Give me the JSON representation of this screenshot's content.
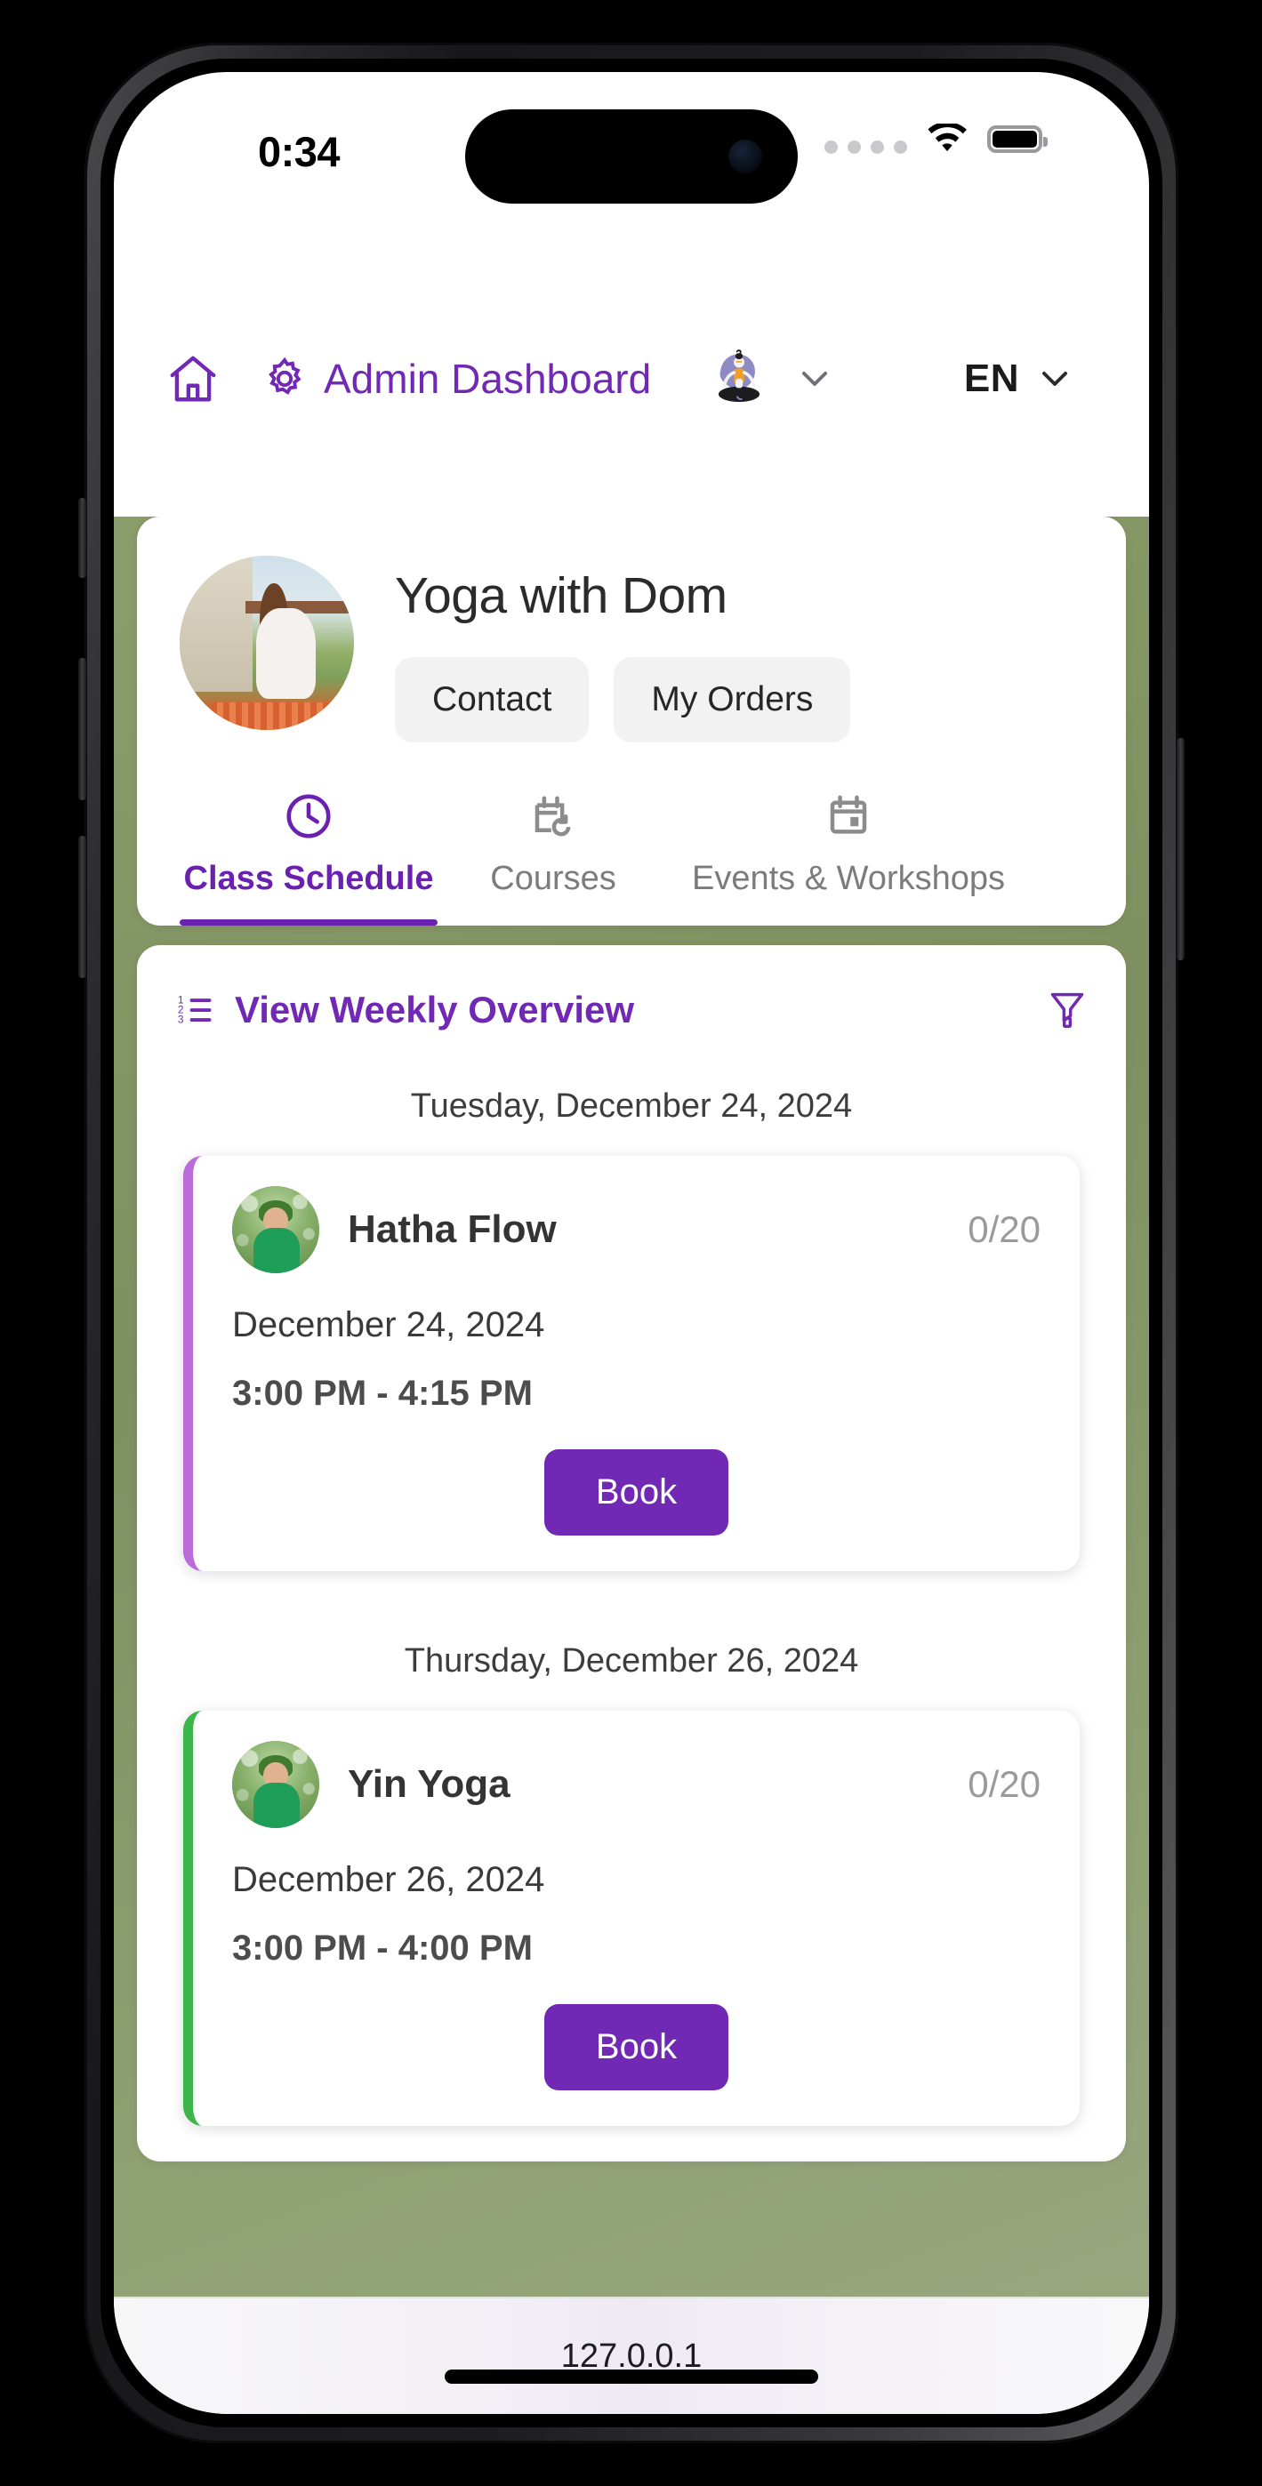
{
  "status_bar": {
    "time": "0:34",
    "signal_icon": "signal-dots-icon",
    "wifi_icon": "wifi-icon",
    "battery_icon": "battery-full-icon"
  },
  "header": {
    "home_icon": "home-icon",
    "gear_icon": "gear-icon",
    "title": "Admin Dashboard",
    "user_avatar_icon": "yoga-meditation-avatar-icon",
    "user_chevron_icon": "chevron-down-icon",
    "language": "EN",
    "language_chevron_icon": "chevron-down-icon",
    "accent_color": "#7028b5"
  },
  "profile": {
    "studio_name": "Yoga with Dom",
    "photo_alt": "yoga-instructor-photo",
    "actions": [
      {
        "label": "Contact",
        "name": "contact-button"
      },
      {
        "label": "My Orders",
        "name": "my-orders-button"
      }
    ]
  },
  "tabs": [
    {
      "label": "Class Schedule",
      "icon": "clock-icon",
      "active": true
    },
    {
      "label": "Courses",
      "icon": "calendar-refresh-icon",
      "active": false
    },
    {
      "label": "Events & Workshops",
      "icon": "calendar-icon",
      "active": false
    }
  ],
  "schedule": {
    "weekly_overview_label": "View Weekly Overview",
    "list_icon": "numbered-list-icon",
    "filter_icon": "filter-funnel-icon",
    "groups": [
      {
        "day_heading": "Tuesday, December 24, 2024",
        "classes": [
          {
            "title": "Hatha Flow",
            "capacity": "0/20",
            "date": "December 24, 2024",
            "time": "3:00 PM - 4:15 PM",
            "book_label": "Book",
            "accent_color": "#bb6bd9"
          }
        ]
      },
      {
        "day_heading": "Thursday, December 26, 2024",
        "classes": [
          {
            "title": "Yin Yoga",
            "capacity": "0/20",
            "date": "December 26, 2024",
            "time": "3:00 PM - 4:00 PM",
            "book_label": "Book",
            "accent_color": "#3cb54a"
          }
        ]
      }
    ]
  },
  "browser": {
    "url": "127.0.0.1"
  },
  "colors": {
    "brand_purple": "#7028b5",
    "page_background_green": "#8b9d6a",
    "card_white": "#ffffff"
  }
}
